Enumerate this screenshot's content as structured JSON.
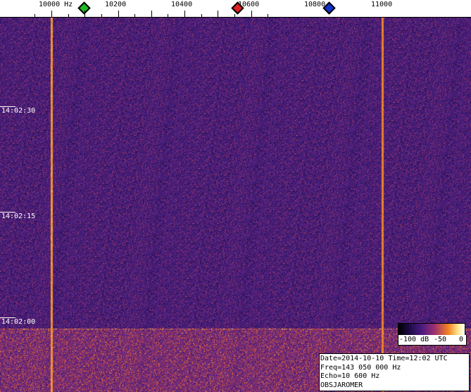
{
  "ruler": {
    "labels": [
      "10000 Hz",
      "10200",
      "10400",
      "10600",
      "10800",
      "11000"
    ],
    "markers": [
      {
        "name": "green-marker",
        "color": "#22bb22"
      },
      {
        "name": "red-marker",
        "color": "#dd2222"
      },
      {
        "name": "blue-marker",
        "color": "#1133cc"
      }
    ]
  },
  "time_labels": [
    "14:02:30",
    "14:02:15",
    "14:02:00"
  ],
  "colorbar": {
    "min_label": "-100 dB",
    "mid_label": "-50",
    "max_label": "0"
  },
  "info": {
    "line1": "Date=2014-10-10 Time=12:02 UTC",
    "line2": "Freq=143 050 000 Hz",
    "line3": "Echo=10 600 Hz",
    "line4": "OBSJAROMER"
  },
  "colors": {
    "background_noise": "#4a1f7a",
    "carrier_line": "#f08020"
  }
}
